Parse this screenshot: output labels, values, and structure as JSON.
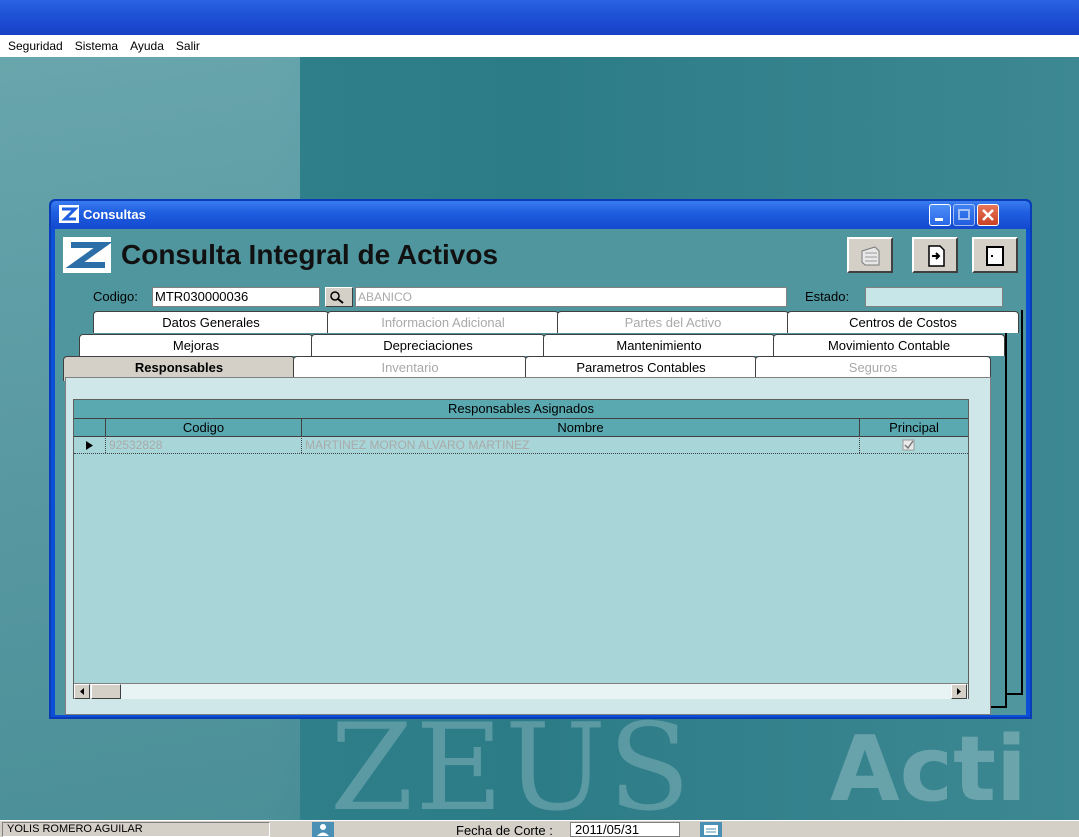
{
  "menu": {
    "items": [
      "Seguridad",
      "Sistema",
      "Ayuda",
      "Salir"
    ]
  },
  "window": {
    "title": "Consultas",
    "heading": "Consulta Integral de Activos"
  },
  "form": {
    "codigo_label": "Codigo:",
    "codigo_value": "MTR030000036",
    "descripcion_value": "ABANICO",
    "estado_label": "Estado:",
    "estado_value": ""
  },
  "tabs": {
    "row1": [
      {
        "label": "Datos Generales",
        "disabled": false
      },
      {
        "label": "Informacion Adicional",
        "disabled": true
      },
      {
        "label": "Partes del Activo",
        "disabled": true
      },
      {
        "label": "Centros de Costos",
        "disabled": false
      }
    ],
    "row2": [
      {
        "label": "Mejoras",
        "disabled": false
      },
      {
        "label": "Depreciaciones",
        "disabled": false
      },
      {
        "label": "Mantenimiento",
        "disabled": false
      },
      {
        "label": "Movimiento Contable",
        "disabled": false
      }
    ],
    "row3": [
      {
        "label": "Responsables",
        "disabled": false,
        "active": true
      },
      {
        "label": "Inventario",
        "disabled": true
      },
      {
        "label": "Parametros Contables",
        "disabled": false
      },
      {
        "label": "Seguros",
        "disabled": true
      }
    ]
  },
  "grid": {
    "caption": "Responsables Asignados",
    "columns": [
      "Codigo",
      "Nombre",
      "Principal"
    ],
    "rows": [
      {
        "codigo": "92532828",
        "nombre": "MARTINEZ MORON ALVARO MARTINEZ",
        "principal": true
      }
    ]
  },
  "statusbar": {
    "user": "YOLIS ROMERO AGUILAR",
    "fecha_label": "Fecha de Corte :",
    "fecha_value": "2011/05/31"
  },
  "watermark": {
    "word1": "ZEUS",
    "word2": "Acti"
  },
  "colors": {
    "titlebar": "#1f5fe0",
    "desktop": "#2c7c88",
    "grid": "#a8d6d8"
  }
}
